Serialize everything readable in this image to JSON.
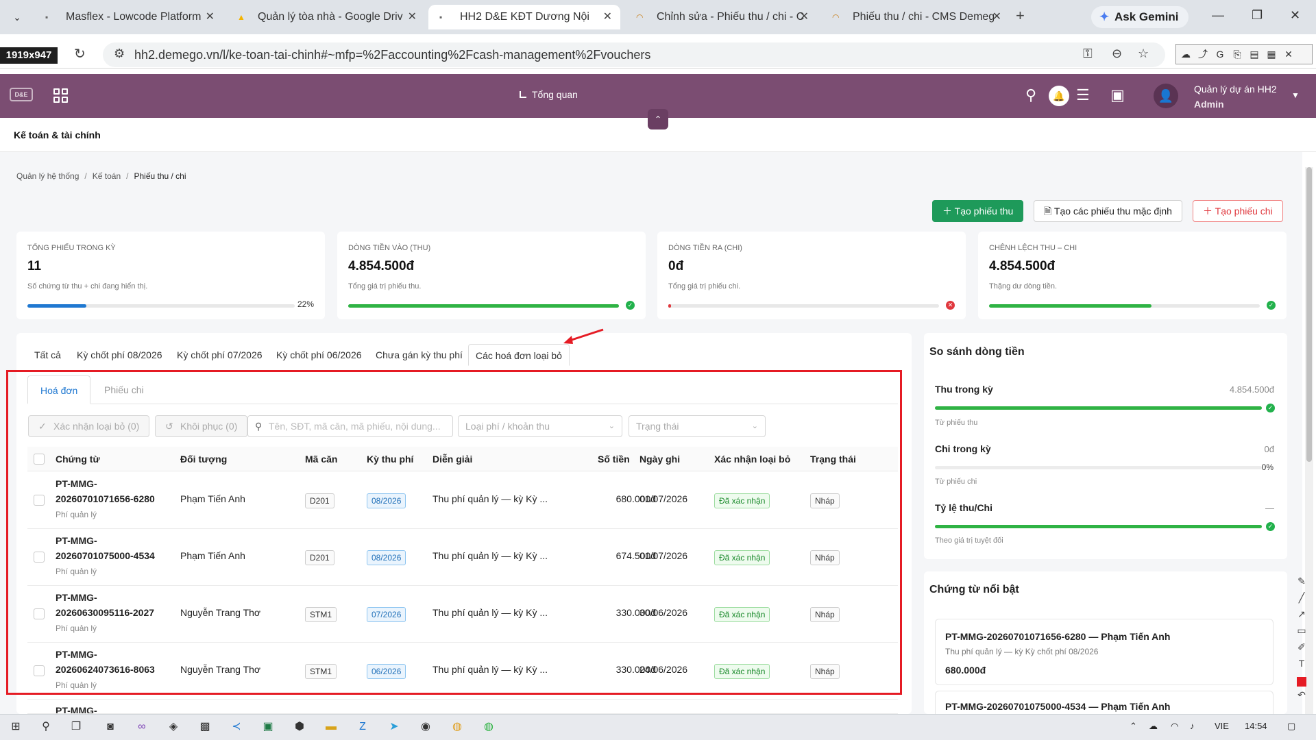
{
  "browser": {
    "tabs": [
      {
        "title": "Masflex - Lowcode Platform",
        "active": false
      },
      {
        "title": "Quản lý tòa nhà - Google Driv",
        "active": false
      },
      {
        "title": "HH2 D&E KĐT Dương Nội",
        "active": true
      },
      {
        "title": "Chỉnh sửa - Phiếu thu / chi - C",
        "active": false
      },
      {
        "title": "Phiếu thu / chi - CMS Demeg",
        "active": false
      }
    ],
    "gemini_label": "Ask Gemini",
    "size_badge": "1919x947",
    "url": "hh2.demego.vn/l/ke-toan-tai-chinh#~mfp=%2Faccounting%2Fcash-management%2Fvouchers"
  },
  "header": {
    "logo_text": "D&E",
    "overview_label": "Tổng quan",
    "user_name": "Quản lý dự án HH2",
    "user_role": "Admin"
  },
  "module_title": "Kế toán & tài chính",
  "breadcrumb": [
    "Quản lý hệ thống",
    "Kế toán",
    "Phiếu thu / chi"
  ],
  "actions": {
    "create_receipt": "Tạo phiếu thu",
    "create_default": "Tạo các phiếu thu mặc định",
    "create_payment": "Tạo phiếu chi"
  },
  "kpis": [
    {
      "label": "TỔNG PHIẾU TRONG KỲ",
      "value": "11",
      "desc": "Số chứng từ thu + chi đang hiển thị.",
      "progress": 0.22,
      "pct_label": "22%",
      "status": "none",
      "color": "#1f78d1"
    },
    {
      "label": "DÒNG TIỀN VÀO (THU)",
      "value": "4.854.500đ",
      "desc": "Tổng giá trị phiếu thu.",
      "progress": 1.0,
      "status": "ok",
      "color": "#2fb344"
    },
    {
      "label": "DÒNG TIỀN RA (CHI)",
      "value": "0đ",
      "desc": "Tổng giá trị phiếu chi.",
      "progress": 0.0,
      "status": "error",
      "color": "#e0383e"
    },
    {
      "label": "CHÊNH LỆCH THU – CHI",
      "value": "4.854.500đ",
      "desc": "Thặng dư dòng tiền.",
      "progress": 0.6,
      "status": "ok",
      "color": "#2fb344"
    }
  ],
  "periods": [
    "Tất cả",
    "Kỳ chốt phí 08/2026",
    "Kỳ chốt phí 07/2026",
    "Kỳ chốt phí 06/2026",
    "Chưa gán kỳ thu phí",
    "Các hoá đơn loại bỏ"
  ],
  "active_period": 5,
  "subtabs": [
    "Hoá đơn",
    "Phiếu chi"
  ],
  "filters": {
    "confirm_remove": "Xác nhận loại bỏ (0)",
    "restore": "Khôi phục (0)",
    "search_placeholder": "Tên, SĐT, mã căn, mã phiếu, nội dung...",
    "fee_type_placeholder": "Loại phí / khoản thu",
    "status_placeholder": "Trạng thái"
  },
  "table": {
    "columns": [
      "Chứng từ",
      "Đối tượng",
      "Mã căn",
      "Kỳ thu phí",
      "Diễn giải",
      "Số tiền",
      "Ngày ghi",
      "Xác nhận loại bỏ",
      "Trạng thái"
    ],
    "rows": [
      {
        "doc_a": "PT-MMG-",
        "doc_b": "20260701071656-6280",
        "doc_type": "Phí quản lý",
        "person": "Phạm Tiến Anh",
        "unit": "D201",
        "period": "08/2026",
        "desc": "Thu phí quản lý — kỳ Kỳ ...",
        "amount": "680.000đ",
        "date": "01/07/2026",
        "confirm": "Đã xác nhận",
        "status": "Nháp"
      },
      {
        "doc_a": "PT-MMG-",
        "doc_b": "20260701075000-4534",
        "doc_type": "Phí quản lý",
        "person": "Phạm Tiến Anh",
        "unit": "D201",
        "period": "08/2026",
        "desc": "Thu phí quản lý — kỳ Kỳ ...",
        "amount": "674.500đ",
        "date": "01/07/2026",
        "confirm": "Đã xác nhận",
        "status": "Nháp"
      },
      {
        "doc_a": "PT-MMG-",
        "doc_b": "20260630095116-2027",
        "doc_type": "Phí quản lý",
        "person": "Nguyễn Trang Thơ",
        "unit": "STM1",
        "period": "07/2026",
        "desc": "Thu phí quản lý — kỳ Kỳ ...",
        "amount": "330.000đ",
        "date": "30/06/2026",
        "confirm": "Đã xác nhận",
        "status": "Nháp"
      },
      {
        "doc_a": "PT-MMG-",
        "doc_b": "20260624073616-8063",
        "doc_type": "Phí quản lý",
        "person": "Nguyễn Trang Thơ",
        "unit": "STM1",
        "period": "06/2026",
        "desc": "Thu phí quản lý — kỳ Kỳ ...",
        "amount": "330.000đ",
        "date": "24/06/2026",
        "confirm": "Đã xác nhận",
        "status": "Nháp"
      }
    ],
    "partial_row_doc": "PT-MMG-"
  },
  "comparison": {
    "title": "So sánh dòng tiền",
    "income_label": "Thu trong kỳ",
    "income_value": "4.854.500đ",
    "income_sub": "Từ phiếu thu",
    "income_progress": 1.0,
    "expense_label": "Chi trong kỳ",
    "expense_value": "0đ",
    "expense_pct": "0%",
    "expense_sub": "Từ phiếu chi",
    "expense_progress": 0.0,
    "ratio_label": "Tỷ lệ thu/Chi",
    "ratio_value": "—",
    "ratio_sub": "Theo giá trị tuyệt đối",
    "ratio_progress": 1.0
  },
  "featured": {
    "title": "Chứng từ nổi bật",
    "items": [
      {
        "title": "PT-MMG-20260701071656-6280 — Phạm Tiến Anh",
        "desc": "Thu phí quản lý — kỳ Kỳ chốt phí 08/2026",
        "amount": "680.000đ"
      },
      {
        "title": "PT-MMG-20260701075000-4534 — Phạm Tiến Anh"
      }
    ]
  },
  "taskbar": {
    "lang": "VIE",
    "time": "14:54"
  }
}
